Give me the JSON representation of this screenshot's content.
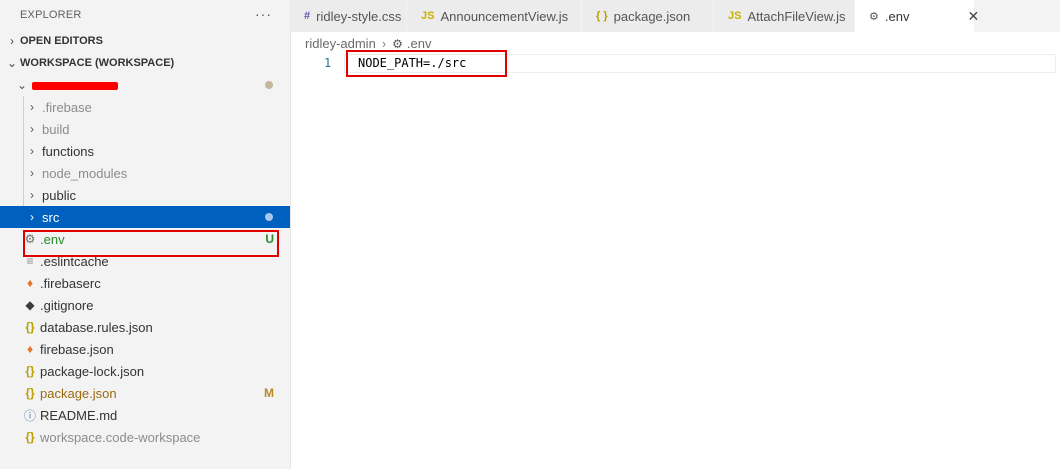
{
  "explorer": {
    "title": "EXPLORER",
    "more": "···",
    "open_editors": "OPEN EDITORS",
    "workspace": "WORKSPACE (WORKSPACE)",
    "items": [
      {
        "label": ".firebase",
        "badge": ""
      },
      {
        "label": "build",
        "badge": ""
      },
      {
        "label": "functions",
        "badge": ""
      },
      {
        "label": "node_modules",
        "badge": ""
      },
      {
        "label": "public",
        "badge": ""
      },
      {
        "label": "src",
        "badge": ""
      },
      {
        "label": ".env",
        "badge": "U"
      },
      {
        "label": ".eslintcache",
        "badge": ""
      },
      {
        "label": ".firebaserc",
        "badge": ""
      },
      {
        "label": ".gitignore",
        "badge": ""
      },
      {
        "label": "database.rules.json",
        "badge": ""
      },
      {
        "label": "firebase.json",
        "badge": ""
      },
      {
        "label": "package-lock.json",
        "badge": ""
      },
      {
        "label": "package.json",
        "badge": "M"
      },
      {
        "label": "README.md",
        "badge": ""
      },
      {
        "label": "workspace.code-workspace",
        "badge": ""
      }
    ]
  },
  "tabs": [
    {
      "icon": "#",
      "label": "ridley-style.css"
    },
    {
      "icon": "JS",
      "label": "AnnouncementView.js"
    },
    {
      "icon": "{ }",
      "label": "package.json"
    },
    {
      "icon": "JS",
      "label": "AttachFileView.js"
    },
    {
      "icon": "⚙",
      "label": ".env",
      "close": "✕"
    }
  ],
  "breadcrumb": {
    "folder": "ridley-admin",
    "file": ".env"
  },
  "editor": {
    "line_number": "1",
    "code": "NODE_PATH=./src"
  },
  "colors": {
    "selection": "#0060c0",
    "highlight_box": "#e00000",
    "untracked": "#2a8a2a",
    "modified": "#b58a2a"
  }
}
